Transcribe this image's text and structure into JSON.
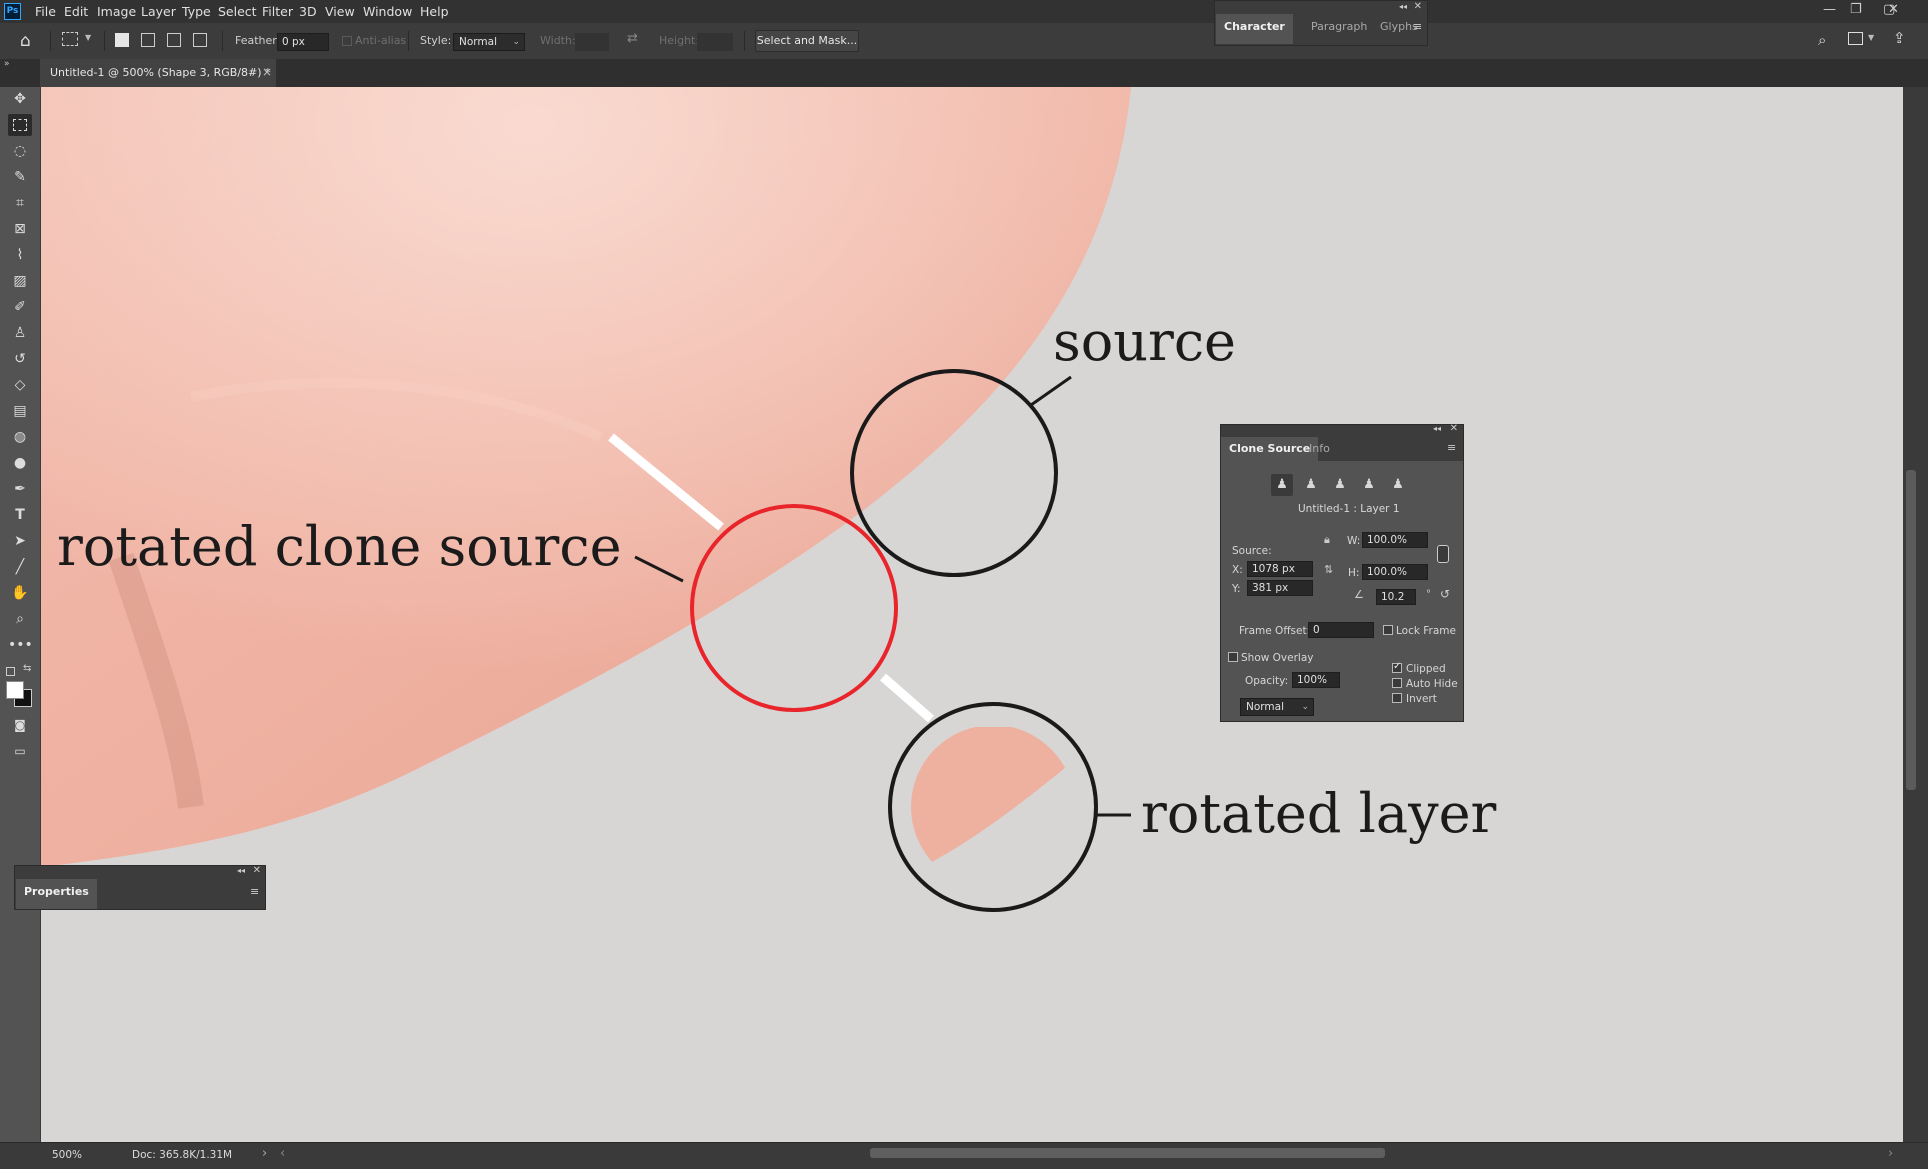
{
  "menubar": {
    "logo": "Ps",
    "items": [
      "File",
      "Edit",
      "Image",
      "Layer",
      "Type",
      "Select",
      "Filter",
      "3D",
      "View",
      "Window",
      "Help"
    ]
  },
  "options": {
    "feather_label": "Feather:",
    "feather_value": "0 px",
    "antialias_label": "Anti-alias",
    "style_label": "Style:",
    "style_value": "Normal",
    "width_label": "Width:",
    "height_label": "Height:",
    "select_mask_label": "Select and Mask..."
  },
  "top_panel": {
    "tabs": [
      "Character",
      "Paragraph",
      "Glyphs"
    ]
  },
  "document": {
    "tab_title": "Untitled-1 @ 500% (Shape 3, RGB/8#) *",
    "close_glyph": "×"
  },
  "canvas": {
    "label_source": "source",
    "label_rotated_clone": "rotated clone source",
    "label_rotated_layer": "rotated layer",
    "colors": {
      "skin": "#f0b3a3",
      "background": "#d8d6d5",
      "ring": "#1a1a1a",
      "clone_ring": "#e8252a",
      "stick": "#ffffff"
    }
  },
  "clone_source": {
    "tabs": [
      "Clone Source",
      "Info"
    ],
    "source_name": "Untitled-1 : Layer 1",
    "source_label": "Source:",
    "x_label": "X:",
    "x_value": "1078 px",
    "y_label": "Y:",
    "y_value": "381 px",
    "w_label": "W:",
    "w_value": "100.0%",
    "h_label": "H:",
    "h_value": "100.0%",
    "angle_value": "10.2",
    "degree": "°",
    "frame_offset_label": "Frame Offset:",
    "frame_offset_value": "0",
    "lock_frame_label": "Lock Frame",
    "lock_frame_checked": false,
    "show_overlay_label": "Show Overlay",
    "show_overlay_checked": false,
    "opacity_label": "Opacity:",
    "opacity_value": "100%",
    "blend_value": "Normal",
    "clipped_label": "Clipped",
    "clipped_checked": true,
    "auto_hide_label": "Auto Hide",
    "auto_hide_checked": false,
    "invert_label": "Invert",
    "invert_checked": false
  },
  "properties": {
    "title": "Properties"
  },
  "status": {
    "zoom": "500%",
    "doc": "Doc: 365.8K/1.31M"
  }
}
